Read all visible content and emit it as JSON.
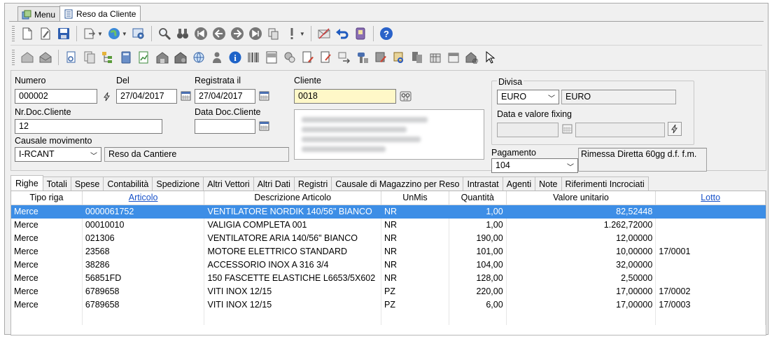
{
  "doc_tabs": [
    {
      "label": "Menu",
      "icon": "home-icon"
    },
    {
      "label": "Reso da Cliente",
      "icon": "document-icon"
    }
  ],
  "toolbar1": [
    "new-document-icon",
    "edit-icon",
    "save-icon",
    "export-icon",
    "globe-icon",
    "settings-icon",
    "search-icon",
    "binoculars-icon",
    "first-icon",
    "prev-icon",
    "next-icon",
    "last-icon",
    "copy-icon",
    "alert-icon",
    "mail-icon",
    "undo-icon",
    "stamp-icon",
    "help-icon"
  ],
  "form": {
    "numero_label": "Numero",
    "numero_value": "000002",
    "del_label": "Del",
    "del_value": "27/04/2017",
    "registrata_label": "Registrata il",
    "registrata_value": "27/04/2017",
    "cliente_label": "Cliente",
    "cliente_value": "0018",
    "nrdoc_label": "Nr.Doc.Cliente",
    "nrdoc_value": "12",
    "datadoc_label": "Data Doc.Cliente",
    "datadoc_value": "",
    "causale_label": "Causale movimento",
    "causale_value": "I-RCANT",
    "causale_desc": "Reso da Cantiere",
    "divisa_label": "Divisa",
    "divisa_value": "EURO",
    "divisa_desc": "EURO",
    "fixing_label": "Data e valore fixing",
    "pagamento_label": "Pagamento",
    "pagamento_value": "104",
    "pagamento_desc": "Rimessa Diretta 60gg d.f. f.m."
  },
  "tabs": [
    "Righe",
    "Totali",
    "Spese",
    "Contabilità",
    "Spedizione",
    "Altri Vettori",
    "Altri Dati",
    "Registri",
    "Causale di Magazzino per Reso",
    "Intrastat",
    "Agenti",
    "Note",
    "Riferimenti Incrociati"
  ],
  "grid": {
    "headers": [
      "Tipo riga",
      "Articolo",
      "Descrizione Articolo",
      "UnMis",
      "Quantità",
      "Valore unitario",
      "Lotto"
    ],
    "rows": [
      [
        "Merce",
        "0000061752",
        "VENTILATORE NORDIK 140/56\" BIANCO",
        "NR",
        "1,00",
        "82,52448",
        ""
      ],
      [
        "Merce",
        "00010010",
        "VALIGIA COMPLETA 001",
        "NR",
        "1,00",
        "1.262,72000",
        ""
      ],
      [
        "Merce",
        "021306",
        "VENTILATORE ARIA 140/56\" BIANCO",
        "NR",
        "190,00",
        "12,00000",
        ""
      ],
      [
        "Merce",
        "23568",
        "MOTORE ELETTRICO STANDARD",
        "NR",
        "101,00",
        "10,00000",
        "17/0001"
      ],
      [
        "Merce",
        "38286",
        "ACCESSORIO INOX A 316 3/4",
        "NR",
        "104,00",
        "32,00000",
        ""
      ],
      [
        "Merce",
        "56851FD",
        "150 FASCETTE ELASTICHE L6653/5X602",
        "NR",
        "128,00",
        "2,50000",
        ""
      ],
      [
        "Merce",
        "6789658",
        "VITI INOX 12/15",
        "PZ",
        "220,00",
        "17,00000",
        "17/0002"
      ],
      [
        "Merce",
        "6789658",
        "VITI INOX 12/15",
        "PZ",
        "6,00",
        "17,00000",
        "17/0003"
      ]
    ],
    "selected_row": 0
  },
  "colors": {
    "selection": "#3d8ee6",
    "link": "#1650c8",
    "highlight_field": "#fff8c8"
  }
}
